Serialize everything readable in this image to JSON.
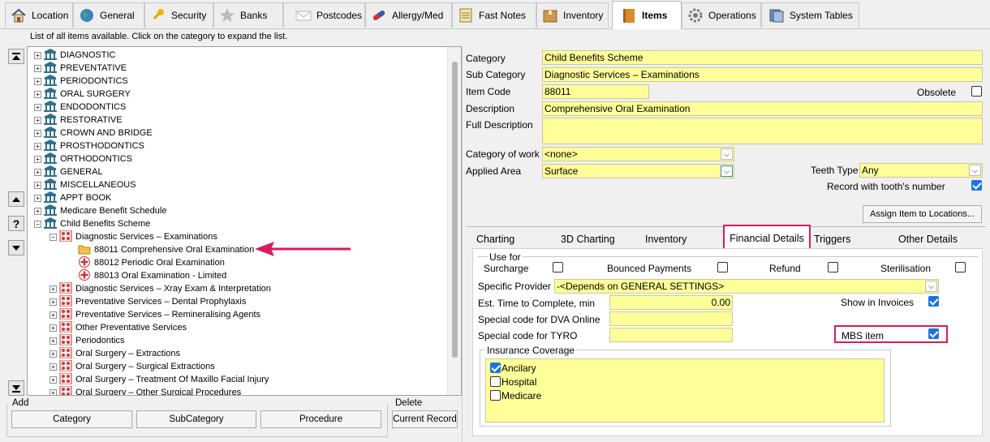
{
  "tabs": [
    {
      "label": "Location",
      "icon": "house-icon"
    },
    {
      "label": "General",
      "icon": "globe-icon"
    },
    {
      "label": "Security",
      "icon": "key-icon"
    },
    {
      "label": "Banks",
      "icon": "star-icon"
    },
    {
      "label": "Postcodes",
      "icon": "envelope-icon"
    },
    {
      "label": "Allergy/Med",
      "icon": "capsule-icon"
    },
    {
      "label": "Fast Notes",
      "icon": "notepad-icon"
    },
    {
      "label": "Inventory",
      "icon": "box-icon"
    },
    {
      "label": "Items",
      "icon": "book-icon"
    },
    {
      "label": "Operations",
      "icon": "gear-icon"
    },
    {
      "label": "System Tables",
      "icon": "tables-icon"
    }
  ],
  "instruction": "List of all items available. Click on the category to expand the list.",
  "tree": {
    "categories": [
      "DIAGNOSTIC",
      "PREVENTATIVE",
      "PERIODONTICS",
      "ORAL SURGERY",
      "ENDODONTICS",
      "RESTORATIVE",
      "CROWN AND BRIDGE",
      "PROSTHODONTICS",
      "ORTHODONTICS",
      "GENERAL",
      "MISCELLANEOUS",
      "APPT BOOK",
      "Medicare Benefit Schedule",
      "Child Benefits Scheme"
    ],
    "subcategory_open": "Diagnostic Services – Examinations",
    "items": [
      "88011 Comprehensive Oral Examination",
      "88012 Periodic Oral Examination",
      "88013 Oral Examination - Limited"
    ],
    "subcategories": [
      "Diagnostic Services  – Xray Exam & Interpretation",
      "Preventative Services – Dental Prophylaxis",
      "Preventative Services – Remineralising Agents",
      "Other Preventative Services",
      "Periodontics",
      "Oral Surgery – Extractions",
      "Oral Surgery – Surgical Extractions",
      "Oral Surgery – Treatment Of Maxillo Facial Injury",
      "Oral Surgery – Other Surgical Procedures"
    ]
  },
  "add_label": "Add",
  "delete_label": "Delete",
  "buttons": {
    "category": "Category",
    "subcategory": "SubCategory",
    "procedure": "Procedure",
    "current_record": "Current Record",
    "assign": "Assign Item to Locations..."
  },
  "form": {
    "category_label": "Category",
    "category": "Child Benefits Scheme",
    "subcategory_label": "Sub Category",
    "subcategory": "Diagnostic Services – Examinations",
    "item_code_label": "Item Code",
    "item_code": "88011",
    "obsolete_label": "Obsolete",
    "description_label": "Description",
    "description": "Comprehensive Oral Examination",
    "full_description_label": "Full Description",
    "full_description": "",
    "category_of_work_label": "Category of work",
    "category_of_work": "<none>",
    "applied_area_label": "Applied Area",
    "applied_area": "Surface",
    "teeth_type_label": "Teeth Type",
    "teeth_type": "Any",
    "record_tooth_label": "Record with tooth's number"
  },
  "subtabs": [
    "Charting",
    "3D Charting",
    "Inventory",
    "Financial Details",
    "Triggers",
    "Other Details"
  ],
  "financial": {
    "use_for": "Use for",
    "surcharge": "Surcharge",
    "bounced": "Bounced Payments",
    "refund": "Refund",
    "sterilisation": "Sterilisation",
    "provider_label": "Specific Provider",
    "provider": "-<Depends on GENERAL SETTINGS>",
    "est_time_label": "Est. Time to Complete, min",
    "est_time": "0.00",
    "show_invoices": "Show in Invoices",
    "dva_label": "Special code for DVA Online",
    "dva": "",
    "tyro_label": "Special code for TYRO",
    "tyro": "",
    "mbs_label": "MBS item",
    "insurance_title": "Insurance Coverage",
    "insurance": [
      "Ancilary",
      "Hospital",
      "Medicare"
    ]
  },
  "colors": {
    "field": "#ffff99",
    "highlight": "#d81b60",
    "check": "#1a73e8"
  }
}
